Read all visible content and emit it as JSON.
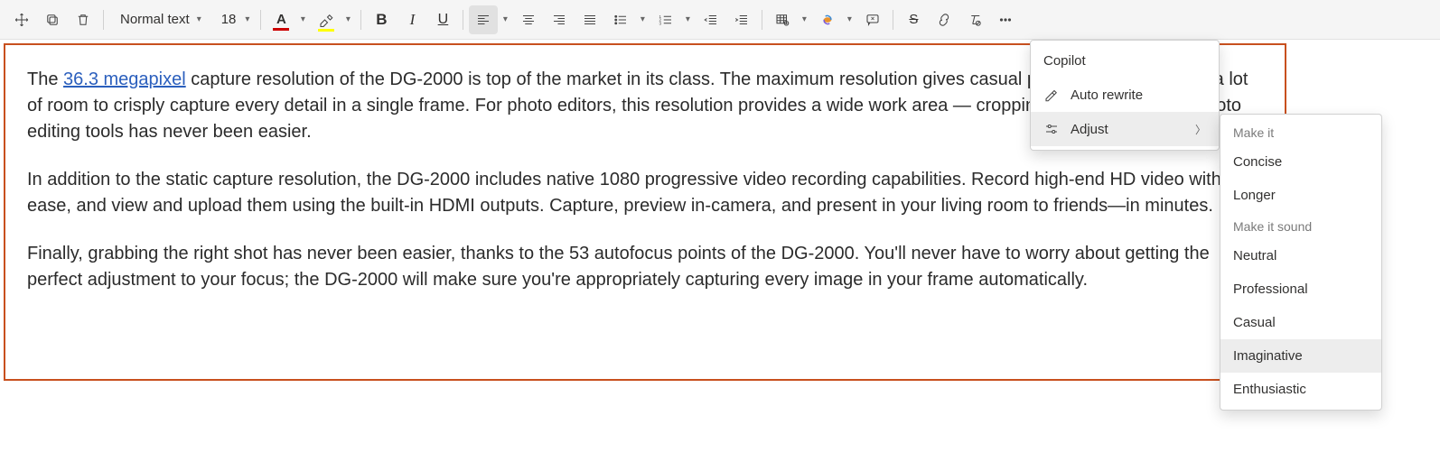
{
  "toolbar": {
    "style_select": "Normal text",
    "font_size": "18"
  },
  "document": {
    "megapixel_link": "36.3 megapixel",
    "para1_pre": "The ",
    "para1_post": " capture resolution of the DG-2000 is top of the market in its class. The maximum resolution gives casual photogs and pros alike a lot of room to crisply capture every detail in a single frame. For photo editors, this resolution provides a wide work area — cropping, and painting with photo editing tools has never been easier.",
    "para2": "In addition to the static capture resolution, the DG-2000 includes native 1080 progressive video recording capabilities. Record high-end HD video with ease, and view and upload them using the built-in HDMI outputs. Capture, preview in-camera, and present in your living room to friends—in minutes.",
    "para3": "Finally, grabbing the right shot has never been easier, thanks to the 53 autofocus points of the DG-2000. You'll never have to worry about getting the perfect adjustment to your focus; the DG-2000 will make sure you're appropriately capturing every image in your frame automatically."
  },
  "copilot_menu": {
    "title": "Copilot",
    "auto_rewrite": "Auto rewrite",
    "adjust": "Adjust"
  },
  "adjust_submenu": {
    "header1": "Make it",
    "concise": "Concise",
    "longer": "Longer",
    "header2": "Make it sound",
    "neutral": "Neutral",
    "professional": "Professional",
    "casual": "Casual",
    "imaginative": "Imaginative",
    "enthusiastic": "Enthusiastic"
  }
}
